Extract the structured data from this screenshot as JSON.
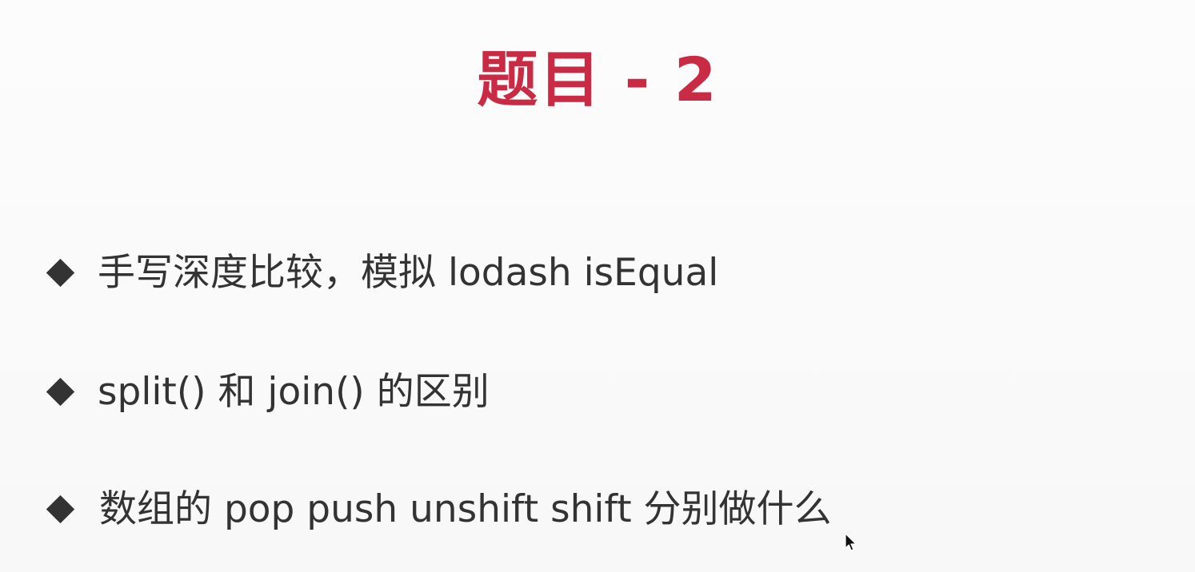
{
  "slide": {
    "title": "题目 - 2",
    "bullets": [
      {
        "text": "手写深度比较，模拟 lodash isEqual",
        "icon": "diamond-bullet-icon"
      },
      {
        "text": "split() 和 join() 的区别",
        "icon": "diamond-bullet-icon"
      },
      {
        "text": "数组的 pop push unshift shift 分别做什么",
        "icon": "diamond-bullet-icon"
      }
    ]
  },
  "colors": {
    "title": "#c92b45",
    "text": "#333333",
    "background": "#fbfbfb"
  },
  "cursor": {
    "icon": "mouse-pointer-icon"
  }
}
